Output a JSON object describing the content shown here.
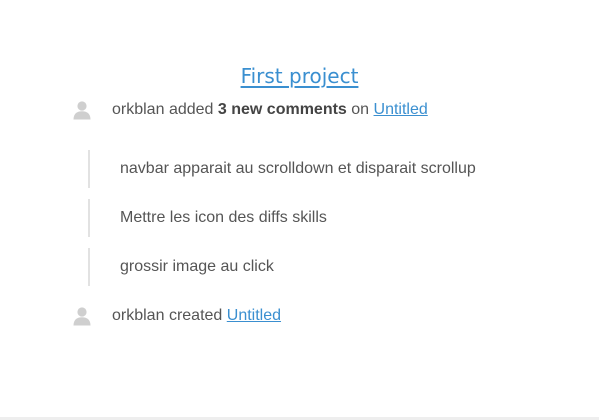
{
  "project": {
    "title": "First project"
  },
  "activities": [
    {
      "user": "orkblan",
      "verb": "added",
      "highlight": "3 new comments",
      "preposition": "on",
      "link_text": "Untitled",
      "icon": "user-avatar-icon"
    },
    {
      "user": "orkblan",
      "verb": "created",
      "link_text": "Untitled",
      "icon": "user-avatar-icon"
    }
  ],
  "comments": [
    "navbar apparait au scrolldown et disparait scrollup",
    "Mettre les icon des diffs skills",
    "grossir image au click"
  ],
  "colors": {
    "link": "#3a8fd0",
    "text": "#555555",
    "thread_border": "#e2e2e2"
  }
}
